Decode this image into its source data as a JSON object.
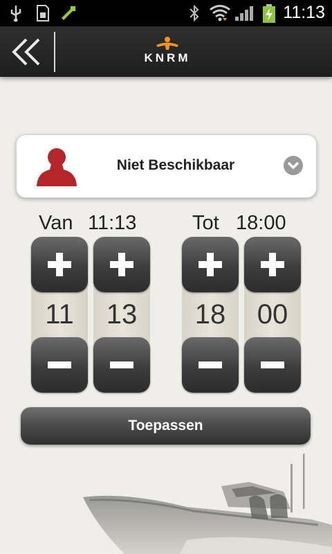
{
  "status_bar": {
    "time": "11:13",
    "icons": [
      "usb-icon",
      "sd-card-icon",
      "sync-icon",
      "bluetooth-icon",
      "wifi-icon",
      "signal-icon",
      "battery-charging-icon"
    ]
  },
  "app_bar": {
    "back_icon": "double-chevron-left-icon",
    "logo_text": "KNRM"
  },
  "availability": {
    "status": "Niet Beschikbaar",
    "avatar_color": "#b5262a",
    "dropdown_icon": "chevron-down-icon"
  },
  "from": {
    "label": "Van",
    "time": "11:13",
    "hour": "11",
    "minute": "13"
  },
  "to": {
    "label": "Tot",
    "time": "18:00",
    "hour": "18",
    "minute": "00"
  },
  "apply_label": "Toepassen",
  "colors": {
    "background": "#efeeea",
    "bar": "#262626",
    "logo_orange": "#f0941d",
    "button_dark": "#3d3d3d"
  }
}
